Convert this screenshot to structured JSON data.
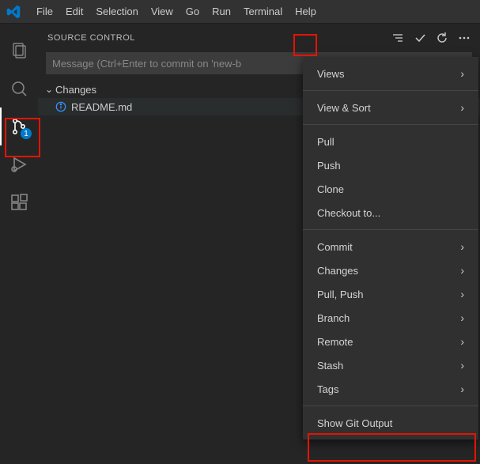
{
  "menu": {
    "file": "File",
    "edit": "Edit",
    "selection": "Selection",
    "view": "View",
    "go": "Go",
    "run": "Run",
    "terminal": "Terminal",
    "help": "Help"
  },
  "activity": {
    "scm_badge": "1"
  },
  "scm": {
    "title": "SOURCE CONTROL",
    "commit_placeholder": "Message (Ctrl+Enter to commit on 'new-b",
    "changes_label": "Changes",
    "file_name": "README.md"
  },
  "context_menu": {
    "views": "Views",
    "view_sort": "View & Sort",
    "pull": "Pull",
    "push": "Push",
    "clone": "Clone",
    "checkout": "Checkout to...",
    "commit": "Commit",
    "changes": "Changes",
    "pull_push": "Pull, Push",
    "branch": "Branch",
    "remote": "Remote",
    "stash": "Stash",
    "tags": "Tags",
    "show_git_output": "Show Git Output"
  }
}
